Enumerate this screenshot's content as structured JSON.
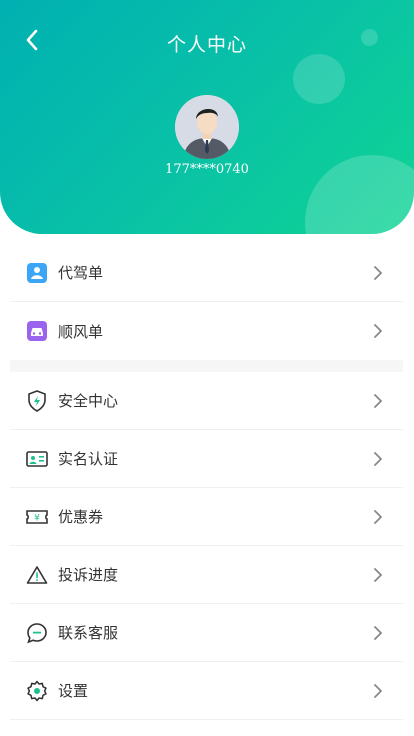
{
  "header": {
    "title": "个人中心",
    "phone": "177****0740",
    "gradient_start": "#00b0b2",
    "gradient_end": "#10d494"
  },
  "group1": [
    {
      "label": "代驾单",
      "icon": "driver-icon"
    },
    {
      "label": "顺风单",
      "icon": "car-icon"
    }
  ],
  "group2": [
    {
      "label": "安全中心",
      "icon": "shield-icon"
    },
    {
      "label": "实名认证",
      "icon": "id-card-icon"
    },
    {
      "label": "优惠券",
      "icon": "coupon-icon"
    },
    {
      "label": "投诉进度",
      "icon": "warning-icon"
    },
    {
      "label": "联系客服",
      "icon": "chat-icon"
    },
    {
      "label": "设置",
      "icon": "gear-icon"
    }
  ]
}
